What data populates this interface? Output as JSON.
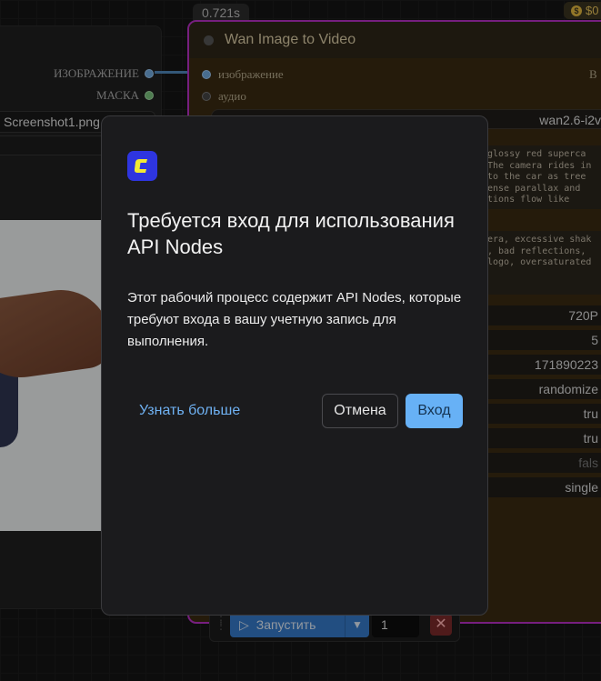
{
  "canvas": {
    "left_node": {
      "outputs": [
        "ИЗОБРАЖЕНИЕ",
        "МАСКА"
      ],
      "file_name": "Screenshot1.png"
    },
    "timing_badge": "0.721s",
    "cost_badge": "$0",
    "right_node": {
      "title": "Wan Image to Video",
      "inputs": [
        "изображение",
        "аудио"
      ],
      "output_label": "B",
      "model": "wan2.6-i2v",
      "prompt_lines": [
        "glossy red superca",
        "The camera rides in",
        "to the car as tree",
        "ense parallax and",
        "tions flow like"
      ],
      "negative_lines": [
        "era, excessive shak",
        ", bad reflections,",
        "logo, oversaturated"
      ],
      "widgets": [
        "720P",
        "5",
        "171890223",
        "randomize",
        "tru",
        "tru",
        "fals",
        "single"
      ]
    },
    "run_bar": {
      "run_label": "Запустить",
      "count": "1"
    }
  },
  "dialog": {
    "title": "Требуется вход для использования API Nodes",
    "body": "Этот рабочий процесс содержит API Nodes, которые требуют входа в вашу учетную запись для выполнения.",
    "learn_more": "Узнать больше",
    "cancel": "Отмена",
    "login": "Вход"
  }
}
